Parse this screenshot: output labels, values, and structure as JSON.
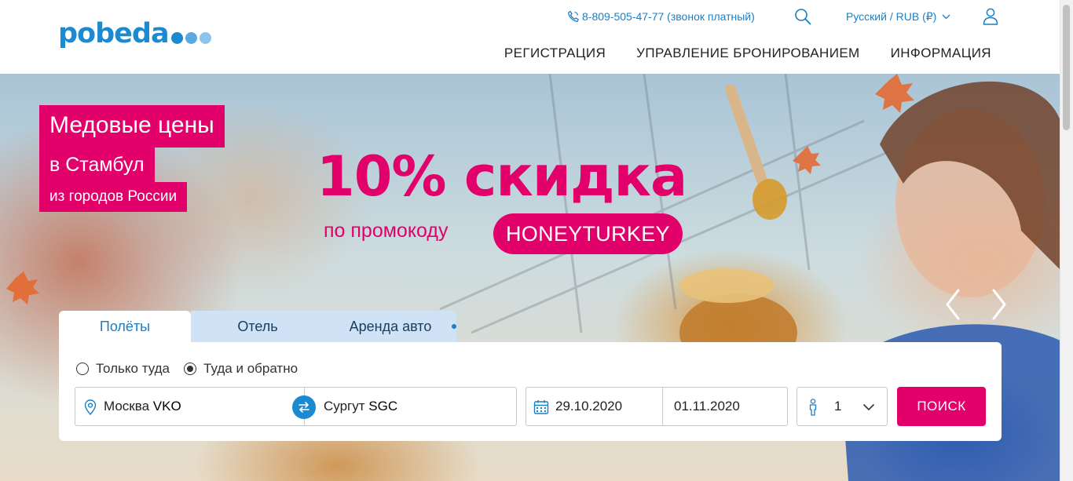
{
  "header": {
    "logo_text": "pobeda",
    "logo_dot_colors": [
      "#1b8ad0",
      "#5aa9e0",
      "#8cc4ee",
      "#bcdcf5"
    ],
    "phone": "8-809-505-47-77 (звонок платный)",
    "language": "Русский / RUB (₽)",
    "nav": [
      "РЕГИСТРАЦИЯ",
      "УПРАВЛЕНИЕ БРОНИРОВАНИЕМ",
      "ИНФОРМАЦИЯ"
    ]
  },
  "banner": {
    "line1": "Медовые цены",
    "line2": "в Стамбул",
    "line3": "из городов России",
    "discount": "10% скидка",
    "promo_label": "по промокоду",
    "promo_code": "HONEYTURKEY"
  },
  "booking": {
    "tabs": [
      "Полёты",
      "Отель",
      "Аренда авто"
    ],
    "active_tab": "Полёты",
    "trip_types": [
      "Только туда",
      "Туда и обратно"
    ],
    "selected_trip": "Туда и обратно",
    "from": {
      "city": "Москва",
      "code": "VKO"
    },
    "to": {
      "city": "Сургут",
      "code": "SGC"
    },
    "date_depart": "29.10.2020",
    "date_return": "01.11.2020",
    "passengers": "1",
    "search_label": "ПОИСК"
  },
  "colors": {
    "brand_blue": "#1b8ad0",
    "accent_pink": "#e2006a",
    "tab_inactive": "#cfe2f6"
  }
}
